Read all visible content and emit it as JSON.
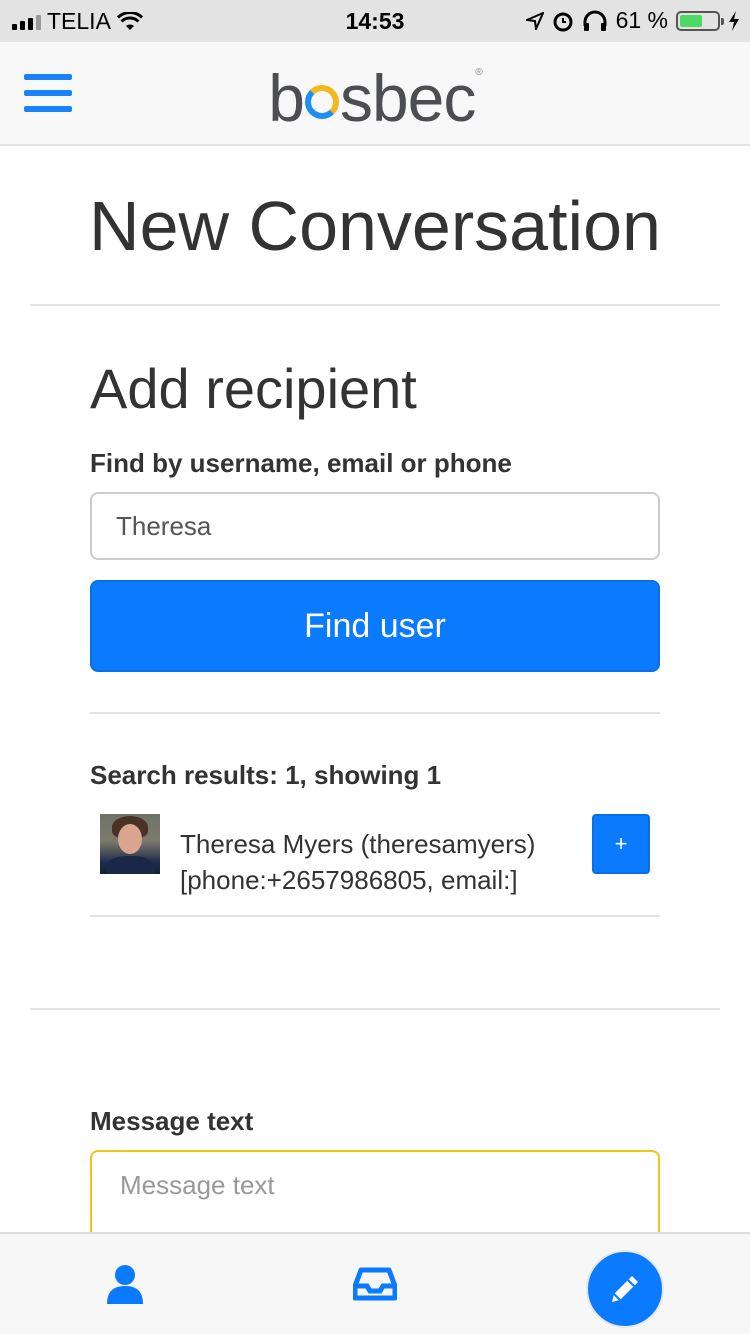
{
  "status_bar": {
    "carrier": "TELIA",
    "time": "14:53",
    "battery_percent": "61 %",
    "battery_level": 0.61
  },
  "header": {
    "logo_text": "bosbec",
    "menu_icon": "hamburger-menu-icon"
  },
  "page": {
    "title": "New Conversation"
  },
  "recipient": {
    "section_title": "Add recipient",
    "search_label": "Find by username, email or phone",
    "search_value": "Theresa",
    "find_button_label": "Find user"
  },
  "results": {
    "summary": "Search results: 1, showing 1",
    "items": [
      {
        "name_line": "Theresa Myers (theresamyers)",
        "contact_line": "[phone:+2657986805, email:]",
        "add_label": "+"
      }
    ]
  },
  "message": {
    "label": "Message text",
    "placeholder": "Message text"
  },
  "bottom_nav": {
    "items": [
      "user-icon",
      "inbox-icon",
      "compose-pencil-icon"
    ]
  },
  "colors": {
    "primary": "#0a7bff",
    "logo_blue": "#1e8ff0",
    "logo_yellow": "#f2b81d",
    "focus_border": "#f2c413",
    "battery_green": "#4cd964"
  }
}
